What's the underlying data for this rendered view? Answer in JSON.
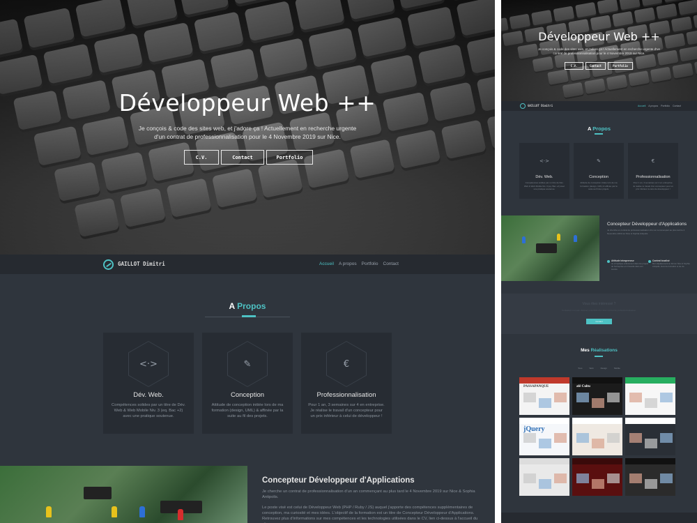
{
  "colors": {
    "accent": "#4ec2c4",
    "background": "#2f353d",
    "navbar": "#262a30",
    "card": "#272c33"
  },
  "hero": {
    "title": "Développeur Web ++",
    "subtitle": "Je conçois & code des sites web, et j'adore ça ! Actuellement en recherche urgente d'un contrat de professionnalisation pour le 4 Novembre 2019 sur Nice.",
    "buttons": [
      "C.V.",
      "Contact",
      "Portfolio"
    ]
  },
  "navbar": {
    "brand": "GAILLOT Dimitri",
    "logo_icon": "logo-icon",
    "links": [
      "Accueil",
      "A propos",
      "Portfolio",
      "Contact"
    ],
    "active": "Accueil"
  },
  "about": {
    "title_prefix": "A",
    "title_accent": "Propos",
    "cards": [
      {
        "icon": "code-icon",
        "glyph": "<·>",
        "title": "Dév. Web.",
        "text": "Compétences solides par un titre de Dév. Web & Web Mobile Niv. 3 (eq. Bac +2) avec une pratique soutenue."
      },
      {
        "icon": "design-tools-icon",
        "glyph": "✎",
        "title": "Conception",
        "text": "Attitude de conception initiée lors de ma formation (design, UML) & affinée par la suite au fil des projets."
      },
      {
        "icon": "euro-icon",
        "glyph": "€",
        "title": "Professionnalisation",
        "text": "Pour 1 an, 3 semaines sur 4 en entreprise. Je réalise le travail d'un concepteur pour un prix inférieur à celui de développeur !"
      }
    ]
  },
  "concept": {
    "title": "Concepteur Développeur d'Applications",
    "p1": "Je cherche un contrat de professionnalisation d'un an commençant au plus tard le 4 Novembre 2019 sur Nice & Sophia Antipolis.",
    "p2": "Le poste visé est celui de Développeur Web (PHP / Ruby / JS) auquel j'apporte des compétences supplémentaires de conception, ma curiosité et mes idées. L'objectif de la formation est un titre de Concepteur Développeur d'Applications. Retrouvez plus d'informations sur mes compétences et les technologies utilisées dans le CV, lien ci-dessus à l'accueil du site.",
    "features": [
      {
        "icon": "person-icon",
        "title": "Attitude intrapreneur",
        "text": "Je m'implique entièrement dans les projets de l'entreprise et m'investis dans son succès."
      },
      {
        "icon": "location-icon",
        "title": "Contrat localisé",
        "text": "Mon déplacement se fait sur Nice & Sophia Antipolis, lieux de formation et de vie."
      }
    ]
  },
  "cta": {
    "title": "Vous êtes intéressé ?",
    "subtitle": "Contactez-moi pour discuter ensemble d'un futur contrat de professionnalisation.",
    "button": "Contact"
  },
  "realisations": {
    "title_prefix": "Mes",
    "title_accent": "Réalisations",
    "filters": [
      "Tous",
      "Web",
      "Design",
      "Mobile"
    ],
    "thumbs": [
      {
        "name": "Passapanque",
        "label": "PASSAPANQUE",
        "bar": "#c0392b",
        "bg": "#f4f4f4"
      },
      {
        "name": "Cafe Cultu",
        "label": "afé Cultu",
        "bar": "#111111",
        "bg": "#1b1b1b"
      },
      {
        "name": "Green shop",
        "label": "",
        "bar": "#27ae60",
        "bg": "#f7f7f7"
      },
      {
        "name": "jQuery",
        "label": "jQuery",
        "bar": "#ffffff",
        "bg": "#f5f7fa"
      },
      {
        "name": "Gallery",
        "label": "",
        "bar": "#ffffff",
        "bg": "#efe9e2"
      },
      {
        "name": "Mobile app",
        "label": "",
        "bar": "#ffffff",
        "bg": "#2a2f36"
      },
      {
        "name": "Wireframe",
        "label": "",
        "bar": "#dddddd",
        "bg": "#e9e9e9"
      },
      {
        "name": "Red portfolio",
        "label": "",
        "bar": "#3a0a0a",
        "bg": "#5a0f0f"
      },
      {
        "name": "Dark dashboard",
        "label": "",
        "bar": "#111111",
        "bg": "#2b2b2b"
      }
    ]
  }
}
